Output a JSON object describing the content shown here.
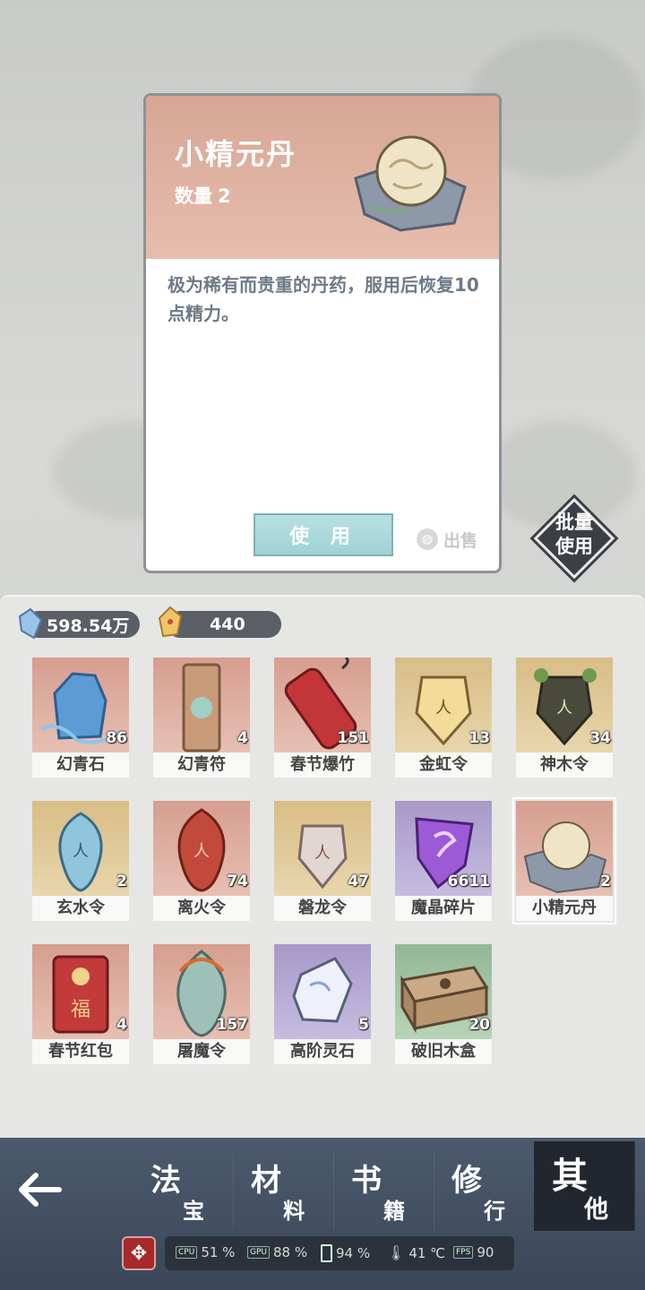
{
  "detail": {
    "title": "小精元丹",
    "qty_label": "数量",
    "qty_value": "2",
    "description": "极为稀有而贵重的丹药，服用后恢复10点精力。",
    "use_label": "使 用",
    "sell_label": "出售",
    "sell_icon": "coin-icon"
  },
  "batch_use": {
    "line1": "批量",
    "line2": "使用"
  },
  "currency": [
    {
      "icon": "blue-crystal-icon",
      "value": "598.54万"
    },
    {
      "icon": "gold-crystal-icon",
      "value": "440"
    }
  ],
  "items": [
    {
      "name": "幻青石",
      "count": "86",
      "bg": "red",
      "icon": "blue-stone-icon"
    },
    {
      "name": "幻青符",
      "count": "4",
      "bg": "red",
      "icon": "talisman-scroll-icon"
    },
    {
      "name": "春节爆竹",
      "count": "151",
      "bg": "red",
      "icon": "firecracker-icon"
    },
    {
      "name": "金虹令",
      "count": "13",
      "bg": "gold",
      "icon": "gold-token-icon"
    },
    {
      "name": "神木令",
      "count": "34",
      "bg": "gold",
      "icon": "wood-token-icon"
    },
    {
      "name": "玄水令",
      "count": "2",
      "bg": "gold",
      "icon": "water-token-icon"
    },
    {
      "name": "离火令",
      "count": "74",
      "bg": "red",
      "icon": "fire-token-icon"
    },
    {
      "name": "磐龙令",
      "count": "47",
      "bg": "gold",
      "icon": "dragon-token-icon"
    },
    {
      "name": "魔晶碎片",
      "count": "6611",
      "bg": "purple",
      "icon": "purple-crystal-icon"
    },
    {
      "name": "小精元丹",
      "count": "2",
      "bg": "red",
      "icon": "pill-icon",
      "selected": true
    },
    {
      "name": "春节红包",
      "count": "4",
      "bg": "red",
      "icon": "red-envelope-icon"
    },
    {
      "name": "屠魔令",
      "count": "157",
      "bg": "red",
      "icon": "demon-slayer-token-icon"
    },
    {
      "name": "高阶灵石",
      "count": "5",
      "bg": "purple",
      "icon": "spirit-stone-icon"
    },
    {
      "name": "破旧木盒",
      "count": "20",
      "bg": "green",
      "icon": "wooden-box-icon"
    }
  ],
  "tabs": [
    {
      "big": "法",
      "small": "宝"
    },
    {
      "big": "材",
      "small": "料"
    },
    {
      "big": "书",
      "small": "籍"
    },
    {
      "big": "修",
      "small": "行"
    },
    {
      "big": "其",
      "small": "他",
      "active": true
    }
  ],
  "perf": [
    {
      "tag": "CPU",
      "value": "51 %"
    },
    {
      "tag": "GPU",
      "value": "88 %"
    },
    {
      "tag": "battery-icon",
      "value": "94 %"
    },
    {
      "tag": "thermometer-icon",
      "value": "41 ℃"
    },
    {
      "tag": "FPS",
      "value": "90"
    }
  ],
  "colors": {
    "card_header": "#d7a695",
    "use_button": "#a7d7d9",
    "nav_bg": "#465368",
    "tab_active": "#22272f"
  }
}
